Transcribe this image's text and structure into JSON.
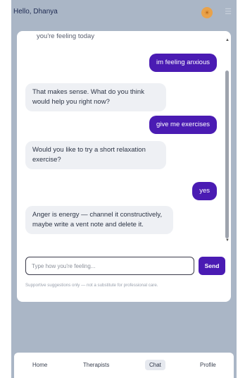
{
  "header": {
    "greeting": "Hello, Dhanya"
  },
  "icons": {
    "theme": "sun-icon",
    "menu": "menu-icon"
  },
  "chat": {
    "truncated_top": "you're feeling today",
    "messages": [
      {
        "role": "user",
        "text": "im feeling anxious"
      },
      {
        "role": "bot",
        "text": "That makes sense. What do you think would help you right now?"
      },
      {
        "role": "user",
        "text": "give me exercises"
      },
      {
        "role": "bot",
        "text": "Would you like to try a short relaxation exercise?"
      },
      {
        "role": "user",
        "text": "yes"
      },
      {
        "role": "bot",
        "text": "Anger is energy — channel it constructively, maybe write a vent note and delete it."
      }
    ]
  },
  "composer": {
    "placeholder": "Type how you're feeling...",
    "send_label": "Send",
    "disclaimer": "Supportive suggestions only — not a substitute for professional care."
  },
  "nav": {
    "items": [
      "Home",
      "Therapists",
      "Chat",
      "Profile"
    ],
    "active": "Chat"
  },
  "colors": {
    "accent": "#4a1bb3",
    "background": "#aab6c6",
    "bot_bubble": "#eef0f4"
  }
}
